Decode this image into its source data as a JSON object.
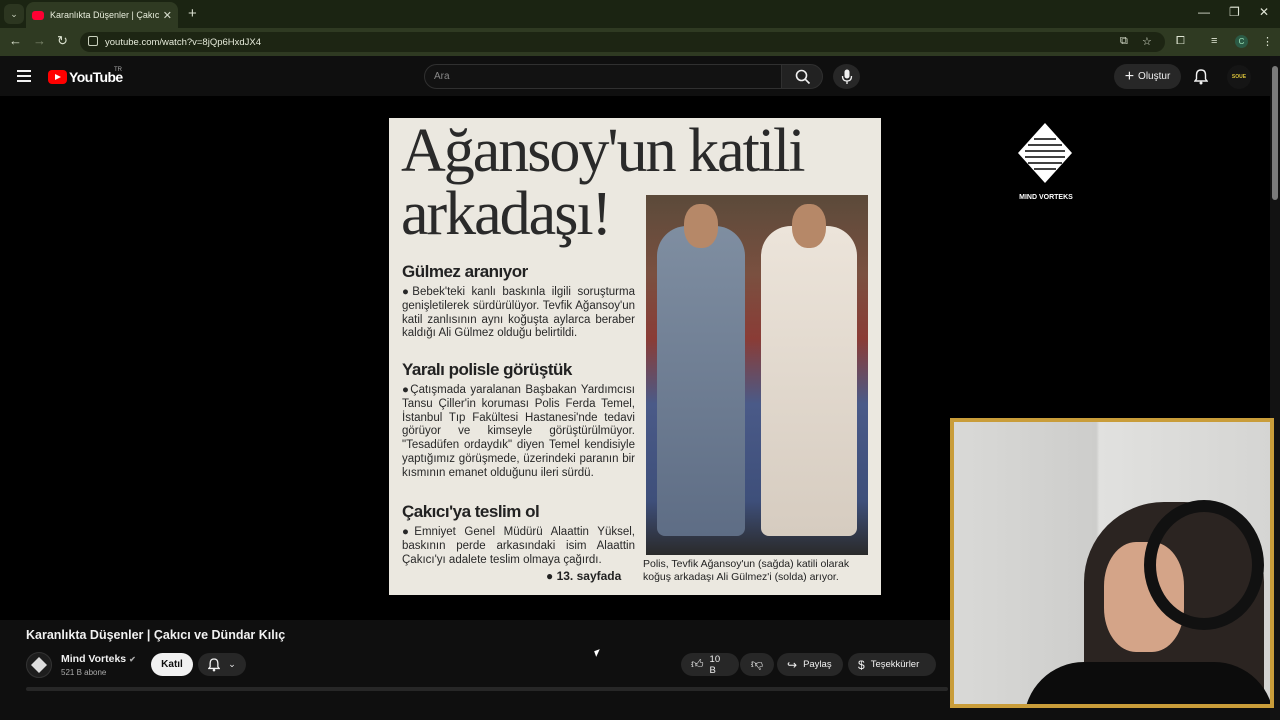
{
  "browser": {
    "tab_title": "Karanlıkta Düşenler | Çakıcı ve Dündar Kılıç",
    "url": "youtube.com/watch?v=8jQp6HxdJX4",
    "new_tab": "+",
    "profile_initial": "C"
  },
  "youtube": {
    "logo_text": "YouTube",
    "country_code": "TR",
    "search_placeholder": "Ara",
    "create_label": "Oluştur",
    "avatar_text": "SOUE"
  },
  "video_frame": {
    "headline": "Ağansoy'un katili arkadaşı!",
    "section1_title": "Gülmez aranıyor",
    "section1_text": "●Bebek'teki kanlı baskınla ilgili soruşturma genişletilerek sürdürülüyor. Tevfik Ağansoy'un katil zanlısının aynı koğuşta aylarca beraber kaldığı Ali Gülmez olduğu belirtildi.",
    "section2_title": "Yaralı polisle görüştük",
    "section2_text": "●Çatışmada yaralanan Başbakan Yardımcısı Tansu Çiller'in koruması Polis Ferda Temel, İstanbul Tıp Fakültesi Hastanesi'nde tedavi görüyor ve kimseyle görüştürülmüyor. \"Tesadüfen ordaydık\" diyen Temel kendisiyle yaptığımız görüşmede, üzerindeki paranın bir kısmının emanet olduğunu ileri sürdü.",
    "section3_title": "Çakıcı'ya teslim ol",
    "section3_text": "●Emniyet Genel Müdürü Alaattin Yüksel, baskının perde arkasındaki isim Alaattin Çakıcı'yı adalete teslim olmaya çağırdı.",
    "page_ref": "● 13. sayfada",
    "caption": "Polis, Tevfik Ağansoy'un (sağda) katili olarak koğuş arkadaşı Ali Gülmez'i (solda) arıyor.",
    "watermark": "MIND VORTEKS"
  },
  "video": {
    "title": "Karanlıkta Düşenler | Çakıcı ve Dündar Kılıç",
    "channel_name": "Mind Vorteks",
    "verified_icon": "✔",
    "subscribers": "521 B abone",
    "join_label": "Katıl",
    "like_count": "10 B",
    "share_label": "Paylaş",
    "thanks_label": "Teşekkürler"
  },
  "colors": {
    "accent": "#ff0000",
    "browser_frame": "#2f3a22",
    "webcam_border": "#c99d3a"
  }
}
